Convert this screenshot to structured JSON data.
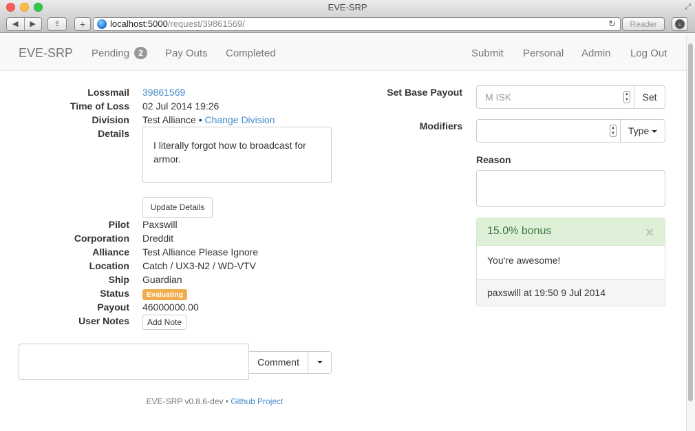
{
  "window": {
    "title": "EVE-SRP"
  },
  "browser": {
    "url_host": "localhost:5000",
    "url_path": "/request/39861569/",
    "reader_label": "Reader"
  },
  "navbar": {
    "brand": "EVE-SRP",
    "pending_label": "Pending",
    "pending_count": "2",
    "payouts_label": "Pay Outs",
    "completed_label": "Completed",
    "submit_label": "Submit",
    "personal_label": "Personal",
    "admin_label": "Admin",
    "logout_label": "Log Out"
  },
  "request": {
    "labels": {
      "lossmail": "Lossmail",
      "time_of_loss": "Time of Loss",
      "division": "Division",
      "details": "Details",
      "pilot": "Pilot",
      "corporation": "Corporation",
      "alliance": "Alliance",
      "location": "Location",
      "ship": "Ship",
      "status": "Status",
      "payout": "Payout",
      "user_notes": "User Notes"
    },
    "lossmail_id": "39861569",
    "time_of_loss": "02 Jul 2014 19:26",
    "division": "Test Alliance",
    "division_separator": "•",
    "change_division_label": "Change Division",
    "details_text": "I literally forgot how to broadcast for armor.",
    "update_details_label": "Update Details",
    "pilot": "Paxswill",
    "corporation": "Dreddit",
    "alliance": "Test Alliance Please Ignore",
    "location": "Catch / UX3-N2 / WD-VTV",
    "ship": "Guardian",
    "status": "Evaluating",
    "payout": "46000000.00",
    "add_note_label": "Add Note"
  },
  "comment": {
    "button_label": "Comment"
  },
  "payout_form": {
    "base_label": "Set Base Payout",
    "base_placeholder": "M ISK",
    "set_label": "Set",
    "modifiers_label": "Modifiers",
    "type_label": "Type",
    "reason_label": "Reason"
  },
  "modifier": {
    "title": "15.0% bonus",
    "note": "You're awesome!",
    "footer": "paxswill at 19:50 9 Jul 2014"
  },
  "footer": {
    "version": "EVE-SRP v0.8.6-dev",
    "separator": "•",
    "github_label": "Github Project"
  },
  "colors": {
    "link": "#428bca",
    "status_evaluating": "#f0ad4e",
    "modifier_bonus_bg": "#dff0d8",
    "modifier_bonus_text": "#3c763d"
  }
}
